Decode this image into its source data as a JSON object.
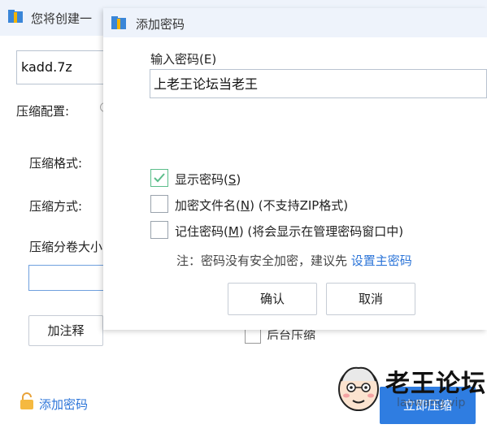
{
  "background_window": {
    "title": "您将创建一",
    "filename": "kadd.7z",
    "compress_config_label": "压缩配置:",
    "format_label": "压缩格式:",
    "method_label": "压缩方式:",
    "split_label": "压缩分卷大小",
    "split_value": "",
    "add_note_button": "加注释",
    "add_password_link": "添加密码",
    "background_compress_label": "后台压缩",
    "start_button": "立即压缩"
  },
  "dialog": {
    "title": "添加密码",
    "password_label": "输入密码(E)",
    "password_value": "上老王论坛当老王",
    "options": [
      {
        "pre": "显示密码(",
        "key": "S",
        "post": ")",
        "checked": true
      },
      {
        "pre": "加密文件名(",
        "key": "N",
        "post": ") (不支持ZIP格式)",
        "checked": false
      },
      {
        "pre": "记住密码(",
        "key": "M",
        "post": ") (将会显示在管理密码窗口中)",
        "checked": false
      }
    ],
    "hint_text": "注：密码没有安全加密，建议先 ",
    "hint_link": "设置主密码",
    "ok_button": "确认",
    "cancel_button": "取消"
  },
  "watermark": {
    "logo_text": "老王论坛",
    "sub_text": "laowang.vip"
  },
  "colors": {
    "accent": "#2f7de1",
    "link": "#2b74d8",
    "titlebar": "#eef3fb",
    "check": "#5bbd8a"
  },
  "icons": {
    "archive": "archive-icon",
    "lock": "lock-icon",
    "check": "checkmark-icon"
  }
}
